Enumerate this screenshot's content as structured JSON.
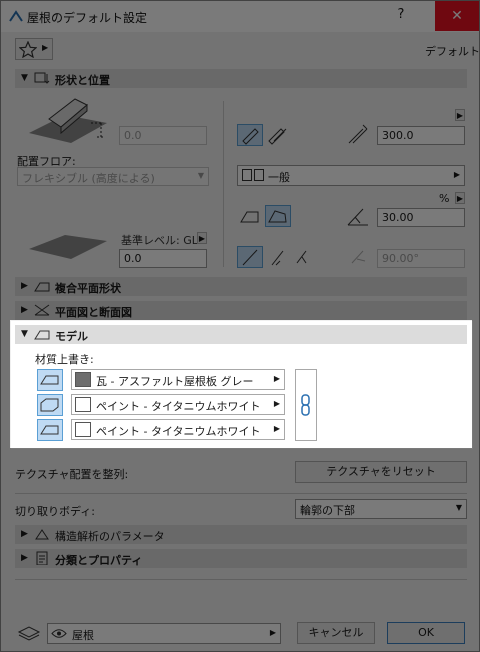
{
  "window": {
    "title": "屋根のデフォルト設定",
    "help": "?",
    "close": "✕"
  },
  "toolbar": {
    "default_label": "デフォルト"
  },
  "sections": {
    "shape": "形状と位置",
    "complex": "複合平面形状",
    "plan": "平面図と断面図",
    "model": "モデル",
    "structural": "構造解析のパラメータ",
    "classification": "分類とプロパティ"
  },
  "shape": {
    "height_value": "0.0",
    "floor_label": "配置フロア:",
    "floor_value": "フレキシブル (高度による)",
    "thickness_value": "300.0",
    "type_value": "一般",
    "percent_label": "%",
    "pitch_value": "30.00",
    "ref_level_label": "基準レベル: GL",
    "ref_level_value": "0.0",
    "angle_value": "90.00°"
  },
  "model": {
    "override_label": "材質上書き:",
    "materials": [
      {
        "name": "瓦 - アスファルト屋根板 グレー",
        "color": "#6e6e6e"
      },
      {
        "name": "ペイント - タイタニウムホワイト",
        "color": "#ffffff"
      },
      {
        "name": "ペイント - タイタニウムホワイト",
        "color": "#ffffff"
      }
    ],
    "texture_align_label": "テクスチャ配置を整列:",
    "texture_reset": "テクスチャをリセット",
    "cut_body_label": "切り取りボディ:",
    "cut_body_value": "輪郭の下部"
  },
  "footer": {
    "layer_value": "屋根",
    "cancel": "キャンセル",
    "ok": "OK"
  },
  "colors": {
    "accent": "#5a9fd4",
    "close": "#e81123",
    "selected_bg": "#bfdaf3"
  }
}
